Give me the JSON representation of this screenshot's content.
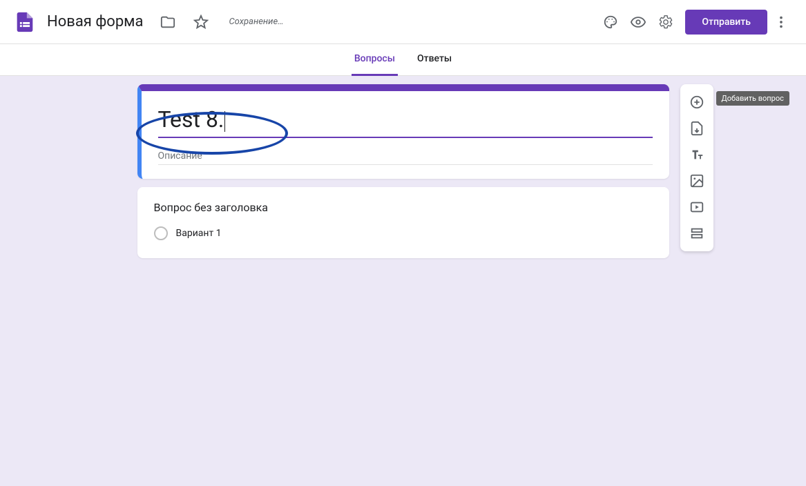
{
  "header": {
    "form_name": "Новая форма",
    "save_status": "Сохранение…",
    "send_label": "Отправить"
  },
  "tabs": {
    "questions": "Вопросы",
    "responses": "Ответы"
  },
  "form": {
    "title": "Test 8.",
    "description_placeholder": "Описание"
  },
  "question": {
    "title": "Вопрос без заголовка",
    "option1": "Вариант 1"
  },
  "tooltip": {
    "add_question": "Добавить вопрос"
  }
}
